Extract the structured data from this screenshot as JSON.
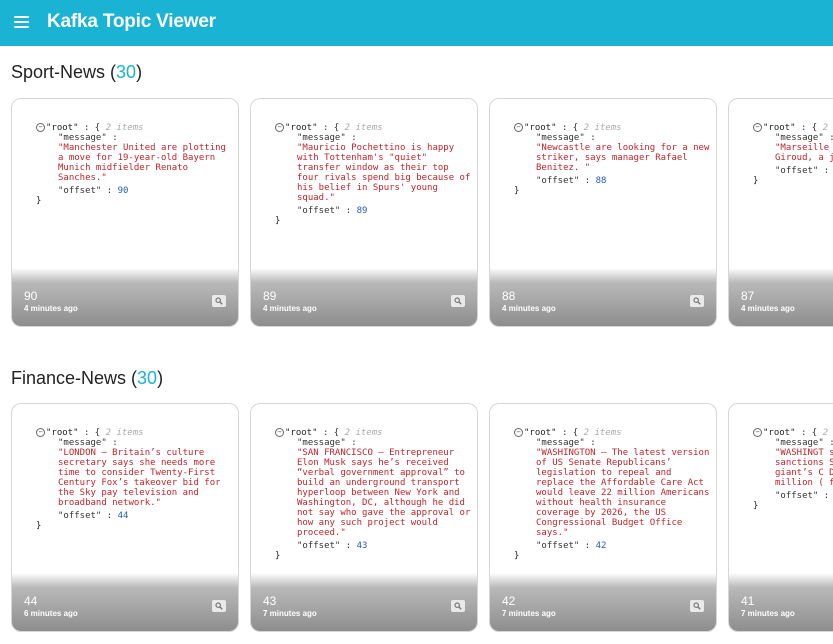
{
  "app": {
    "title": "Kafka Topic Viewer"
  },
  "json_labels": {
    "root": "\"root\"",
    "meta": "2 items",
    "message_key": "\"message\"",
    "offset_key": "\"offset\"",
    "open": ": {",
    "colon": ":",
    "close": "}"
  },
  "sections": [
    {
      "name": "Sport-News",
      "count": "30",
      "cards": [
        {
          "message": "\"Manchester United are plotting a move for 19-year-old Bayern Munich midfielder Renato Sanches.\"",
          "offset": "90",
          "time": "4 minutes ago"
        },
        {
          "message": "\"Mauricio Pochettino is happy with Tottenham's \"quiet\" transfer window as their top four rivals spend big because of his belief in Spurs' young squad.\"",
          "offset": "89",
          "time": "4 minutes ago"
        },
        {
          "message": "\"Newcastle are looking for a new striker, says manager Rafael Benitez. \"",
          "offset": "88",
          "time": "4 minutes ago"
        },
        {
          "message": "\"Marseille Garcia ha Arsenal s Giroud, a joining t",
          "offset": "87",
          "time": "4 minutes ago"
        }
      ]
    },
    {
      "name": "Finance-News",
      "count": "30",
      "cards": [
        {
          "message": "\"LONDON — Britain’s culture secretary says she needs more time to consider Twenty-First Century Fox’s takeover bid for the Sky pay television and broadband network.\"",
          "offset": "44",
          "time": "6 minutes ago"
        },
        {
          "message": "\"SAN FRANCISCO — Entrepreneur Elon Musk says he’s received “verbal government approval” to build an underground transport hyperloop between New York and Washington, DC, although he did not say who gave the approval or how any such project would proceed.\"",
          "offset": "43",
          "time": "7 minutes ago"
        },
        {
          "message": "\"WASHINGTON — The latest version of US Senate Republicans’ legislation to repeal and replace the Affordable Care Act would leave 22 million Americans without health insurance coverage by 2026, the US Congressional Budget Office says.\"",
          "offset": "42",
          "time": "7 minutes ago"
        },
        {
          "message": "\"WASHINGT showed “r disregard sanctions Secretary Tillerson giant’s C Departmen handed do million ( fine.\"",
          "offset": "41",
          "time": "7 minutes ago"
        }
      ]
    }
  ]
}
